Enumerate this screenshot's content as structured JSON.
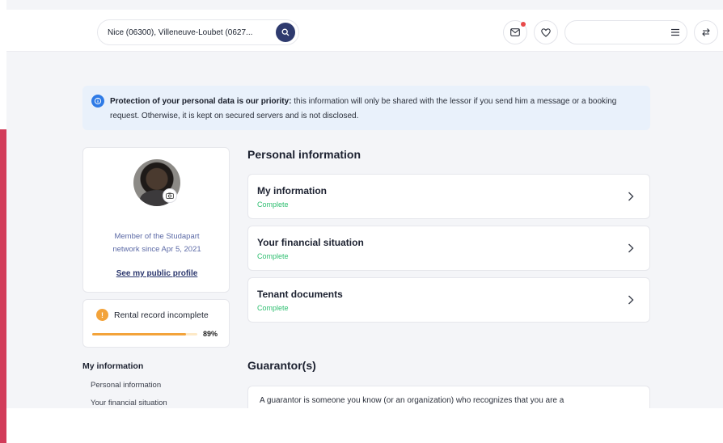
{
  "header": {
    "search_text": "Nice (06300), Villeneuve-Loubet (0627...",
    "search_icon": "search-icon",
    "messages_icon": "mail-icon",
    "favorites_icon": "heart-icon",
    "menu_icon": "hamburger-icon",
    "switch_icon": "swap-arrows-icon"
  },
  "banner": {
    "bold_text": "Protection of your personal data is our priority:",
    "body_text": " this information will only be shared with the lessor if you send him a message or a booking request. Otherwise, it is kept on secured servers and is not disclosed."
  },
  "profile": {
    "member_line1": "Member of the Studapart",
    "member_line2": "network since Apr 5, 2021",
    "public_profile_link": "See my public profile"
  },
  "rental_record": {
    "title": "Rental record incomplete",
    "progress": 0.89,
    "progress_label": "89%"
  },
  "sidebar_nav": {
    "title": "My information",
    "items": [
      {
        "label": "Personal information"
      },
      {
        "label": "Your financial situation"
      }
    ]
  },
  "personal_information": {
    "title": "Personal information",
    "rows": [
      {
        "title": "My information",
        "status": "Complete"
      },
      {
        "title": "Your financial situation",
        "status": "Complete"
      },
      {
        "title": "Tenant documents",
        "status": "Complete"
      }
    ]
  },
  "guarantors": {
    "title": "Guarantor(s)",
    "intro": "A guarantor is someone you know (or an organization) who recognizes that you are a"
  },
  "colors": {
    "accent_red": "#d23c5a",
    "navy": "#2e3a6e",
    "complete_green": "#2fbf71",
    "warning_orange": "#f3a33a",
    "info_blue": "#2f7be6"
  }
}
